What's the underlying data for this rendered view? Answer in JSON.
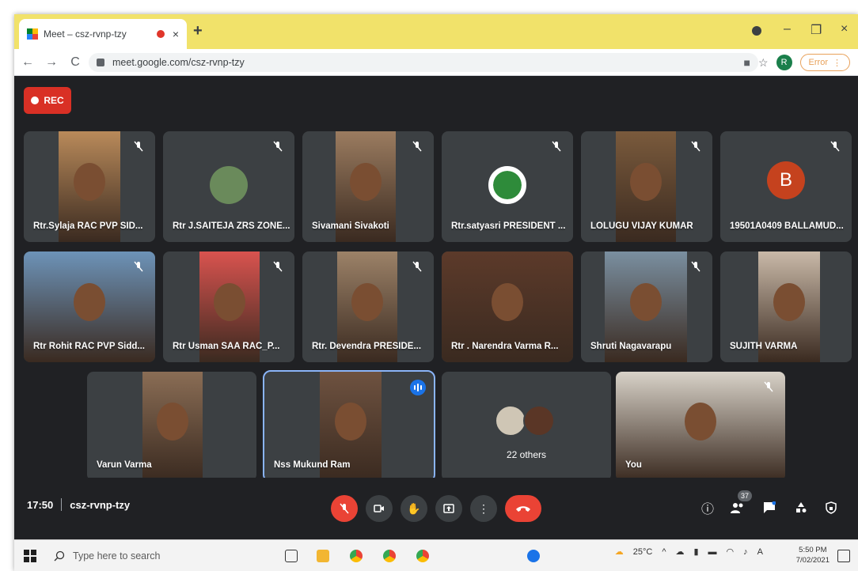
{
  "browser": {
    "tab_title": "Meet – csz-rvnp-tzy",
    "tab_close": "×",
    "new_tab": "+",
    "url": "meet.google.com/csz-rvnp-tzy",
    "profile_initial": "R",
    "error_label": "Error",
    "back_icon": "←",
    "forward_icon": "→",
    "reload_icon": "C",
    "star_icon": "☆",
    "cast_icon": "■",
    "minimize_icon": "–",
    "restore_icon": "❐",
    "close_icon": "×"
  },
  "meet": {
    "rec_label": "REC",
    "meeting_time": "17:50",
    "meeting_code": "csz-rvnp-tzy",
    "people_count": "37",
    "others_label": "22 others",
    "avatar_letter": "B",
    "participants": [
      {
        "name": "Rtr.Sylaja RAC PVP SID...",
        "muted": true,
        "bg": "#b98a5a"
      },
      {
        "name": "Rtr J.SAITEJA ZRS ZONE...",
        "muted": true,
        "bg": "#6a8a5b"
      },
      {
        "name": "Sivamani Sivakoti",
        "muted": true,
        "bg": "#9b7c60"
      },
      {
        "name": "Rtr.satyasri PRESIDENT ...",
        "muted": true,
        "bg": "#2e8b3a"
      },
      {
        "name": "LOLUGU VIJAY KUMAR",
        "muted": true,
        "bg": "#7a5a3c"
      },
      {
        "name": "19501A0409 BALLAMUD...",
        "muted": true,
        "bg": "#c5421e"
      },
      {
        "name": "Rtr Rohit RAC PVP Sidd...",
        "muted": true,
        "bg": "#6d93b8"
      },
      {
        "name": "Rtr Usman SAA RAC_P...",
        "muted": true,
        "bg": "#d9534f"
      },
      {
        "name": "Rtr. Devendra PRESIDE...",
        "muted": true,
        "bg": "#9c8268"
      },
      {
        "name": "Rtr . Narendra Varma R...",
        "muted": false,
        "bg": "#5c3a2a"
      },
      {
        "name": "Shruti Nagavarapu",
        "muted": true,
        "bg": "#7a8fa0"
      },
      {
        "name": "SUJITH VARMA",
        "muted": false,
        "bg": "#c9b9a8"
      },
      {
        "name": "Varun Varma",
        "muted": false,
        "bg": "#8a6d55"
      },
      {
        "name": "Nss Mukund Ram",
        "muted": false,
        "speaking": true,
        "bg": "#6e5240"
      },
      {
        "name": "You",
        "muted": true,
        "bg": "#d8d2c8"
      }
    ],
    "controls": {
      "mic_icon": "mic-off-icon",
      "cam_icon": "camera-icon",
      "hand_icon": "raise-hand-icon",
      "present_icon": "present-icon",
      "more_icon": "more-icon",
      "hangup_icon": "hangup-icon",
      "info_icon": "ⓘ",
      "chat_icon": "chat-icon",
      "activities_icon": "activities-icon",
      "safety_icon": "safety-icon"
    }
  },
  "taskbar": {
    "search_placeholder": "Type here to search",
    "temperature": "25°C",
    "time": "5:50 PM",
    "date": "7/02/2021"
  },
  "colors": {
    "tab_bar": "#f1e26a",
    "meet_bg": "#202124",
    "tile_bg": "#3c4043",
    "accent_red": "#ea4335",
    "speaking_blue": "#1a73e8"
  }
}
